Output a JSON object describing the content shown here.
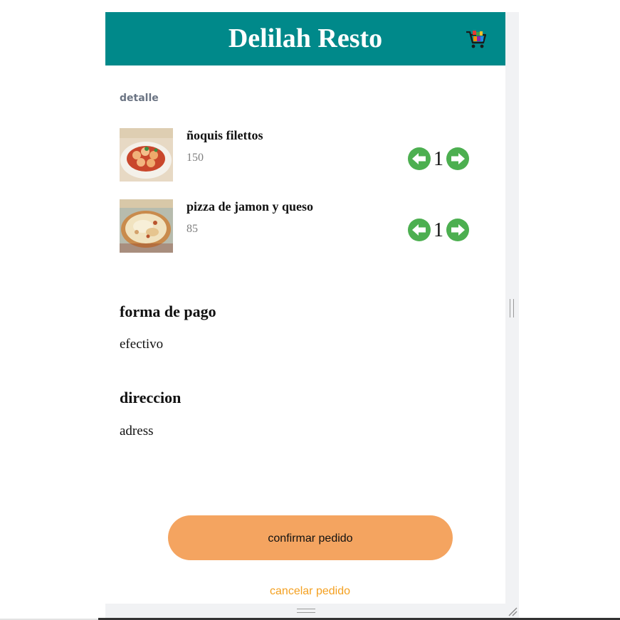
{
  "app": {
    "title": "Delilah Resto",
    "cart_icon": "shopping-cart-icon"
  },
  "order": {
    "section_label": "detalle",
    "items": [
      {
        "name": "ñoquis filettos",
        "price": "150",
        "quantity": "1",
        "image": "gnocchi-dish-photo"
      },
      {
        "name": "pizza de jamon y queso",
        "price": "85",
        "quantity": "1",
        "image": "ham-cheese-pizza-photo"
      }
    ]
  },
  "payment": {
    "heading": "forma de pago",
    "value": "efectivo"
  },
  "address": {
    "heading": "direccion",
    "value": "adress"
  },
  "actions": {
    "confirm_label": "confirmar pedido",
    "cancel_label": "cancelar pedido"
  },
  "colors": {
    "header": "#00898a",
    "confirm_button": "#f4a460",
    "cancel_link": "#f4a020",
    "qty_arrows": "#4caf50",
    "section_label": "#6b7483"
  }
}
